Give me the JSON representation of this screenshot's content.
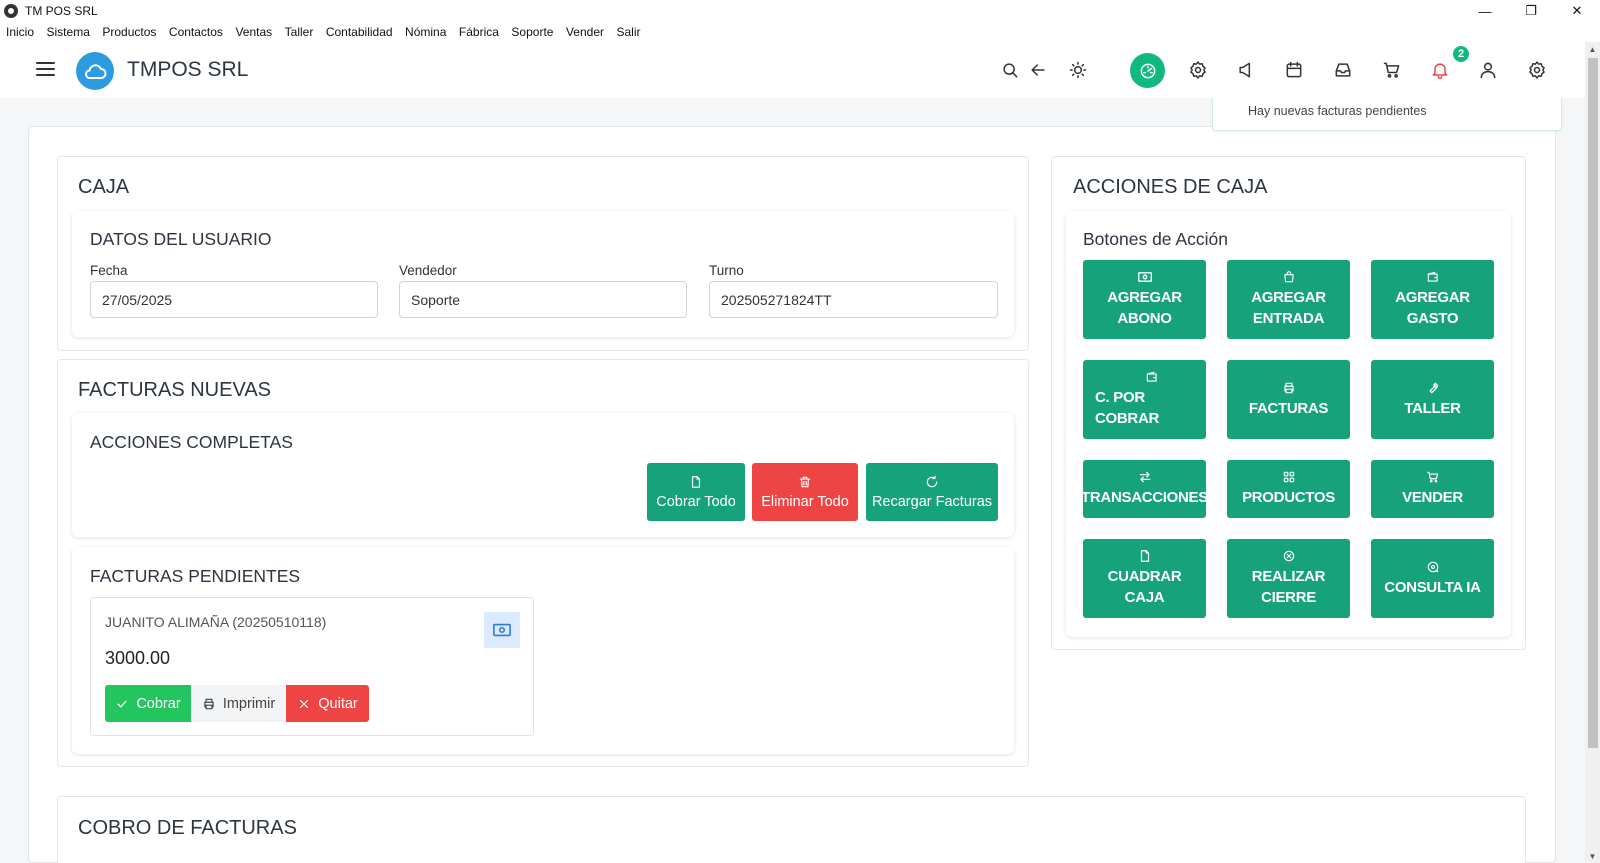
{
  "window": {
    "title": "TM POS SRL",
    "minimize": "—",
    "maximize": "❐",
    "close": "✕"
  },
  "menu": [
    "Inicio",
    "Sistema",
    "Productos",
    "Contactos",
    "Ventas",
    "Taller",
    "Contabilidad",
    "Nómina",
    "Fábrica",
    "Soporte",
    "Vender",
    "Salir"
  ],
  "header": {
    "brand": "TMPOS SRL",
    "notification_count": "2"
  },
  "toast": {
    "message": "Hay nuevas facturas pendientes"
  },
  "caja": {
    "title": "CAJA",
    "user_section_title": "DATOS DEL USUARIO",
    "fecha_label": "Fecha",
    "fecha_value": "27/05/2025",
    "vendedor_label": "Vendedor",
    "vendedor_value": "Soporte",
    "turno_label": "Turno",
    "turno_value": "202505271824TT"
  },
  "facturas_nuevas": {
    "title": "FACTURAS NUEVAS",
    "acciones_title": "ACCIONES COMPLETAS",
    "cobrar_todo": "Cobrar Todo",
    "eliminar_todo": "Eliminar Todo",
    "recargar": "Recargar Facturas"
  },
  "pendientes": {
    "title": "FACTURAS PENDIENTES",
    "invoice": {
      "name": "JUANITO ALIMAÑA (20250510118)",
      "amount": "3000.00",
      "cobrar": "Cobrar",
      "imprimir": "Imprimir",
      "quitar": "Quitar"
    }
  },
  "acciones_caja": {
    "title": "ACCIONES DE CAJA",
    "subtitle": "Botones de Acción",
    "buttons": [
      {
        "line1": "AGREGAR",
        "line2": "ABONO",
        "icon": "cash-icon"
      },
      {
        "line1": "AGREGAR",
        "line2": "ENTRADA",
        "icon": "bag-icon"
      },
      {
        "line1": "AGREGAR",
        "line2": "GASTO",
        "icon": "wallet-icon"
      },
      {
        "line1": "C. POR",
        "line2": "COBRAR",
        "icon": "wallet-icon"
      },
      {
        "line1": "FACTURAS",
        "line2": "",
        "icon": "printer-icon"
      },
      {
        "line1": "TALLER",
        "line2": "",
        "icon": "wrench-icon"
      },
      {
        "line1": "TRANSACCIONES",
        "line2": "",
        "icon": "transfer-icon"
      },
      {
        "line1": "PRODUCTOS",
        "line2": "",
        "icon": "grid-icon"
      },
      {
        "line1": "VENDER",
        "line2": "",
        "icon": "cart-icon"
      },
      {
        "line1": "CUADRAR",
        "line2": "CAJA",
        "icon": "file-icon"
      },
      {
        "line1": "REALIZAR",
        "line2": "CIERRE",
        "icon": "circle-x-icon"
      },
      {
        "line1": "CONSULTA IA",
        "line2": "",
        "icon": "chat-search-icon"
      }
    ]
  },
  "cobro": {
    "title": "COBRO DE FACTURAS"
  },
  "colors": {
    "accent_green": "#16a37b",
    "danger_red": "#ef4444",
    "brand_blue": "#2e9be0"
  }
}
